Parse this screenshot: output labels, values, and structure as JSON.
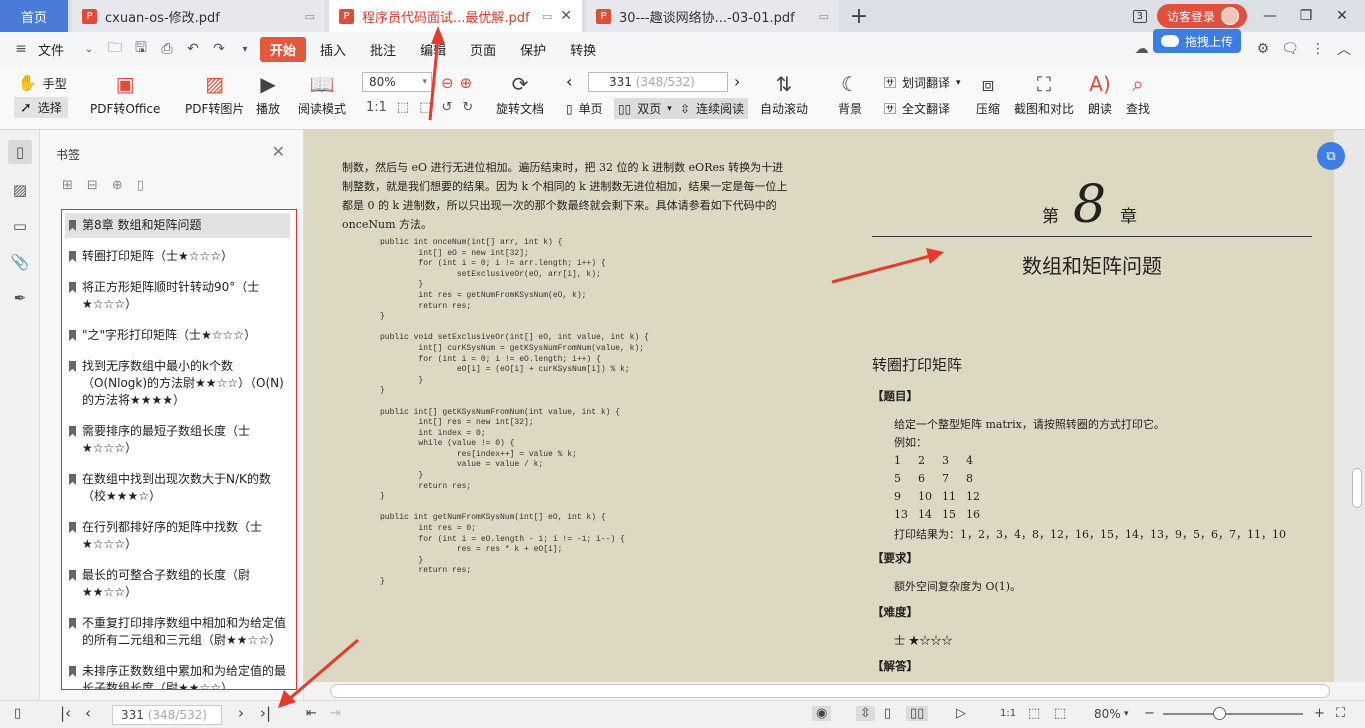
{
  "tabs": {
    "home": "首页",
    "items": [
      {
        "title": "cxuan-os-修改.pdf"
      },
      {
        "title": "程序员代码面试...最优解.pdf"
      },
      {
        "title": "30---趣谈网络协...-03-01.pdf"
      }
    ],
    "new_tab": "+",
    "window_count": "3",
    "visitor_login": "访客登录"
  },
  "menubar": {
    "file": "文件",
    "items": [
      "开始",
      "插入",
      "批注",
      "编辑",
      "页面",
      "保护",
      "转换"
    ],
    "upload": "拖拽上传"
  },
  "toolbar": {
    "hand": "手型",
    "select": "选择",
    "pdf_to_office": "PDF转Office",
    "pdf_to_image": "PDF转图片",
    "play": "播放",
    "read_mode": "阅读模式",
    "zoom": "80%",
    "rotate": "旋转文档",
    "page_current": "331",
    "page_total": "(348/532)",
    "single": "单页",
    "double": "双页",
    "continuous": "连续阅读",
    "auto_scroll": "自动滚动",
    "background": "背景",
    "word_translate": "划词翻译",
    "full_translate": "全文翻译",
    "compress": "压缩",
    "screenshot_compare": "截图和对比",
    "read_aloud": "朗读",
    "search": "查找"
  },
  "bookmarks": {
    "title": "书签",
    "items": [
      "第8章 数组和矩阵问题",
      "转圈打印矩阵（士★☆☆☆）",
      "将正方形矩阵顺时针转动90°（士★☆☆☆）",
      "\"之\"字形打印矩阵（士★☆☆☆）",
      "找到无序数组中最小的k个数（O(Nlogk)的方法尉★★☆☆）（O(N)的方法将★★★★）",
      "需要排序的最短子数组长度（士★☆☆☆）",
      "在数组中找到出现次数大于N/K的数（校★★★☆）",
      "在行列都排好序的矩阵中找数（士★☆☆☆）",
      "最长的可整合子数组的长度（尉★★☆☆）",
      "不重复打印排序数组中相加和为给定值的所有二元组和三元组（尉★★☆☆）",
      "未排序正数数组中累加和为给定值的最长子数组长度（尉★★☆☆）"
    ]
  },
  "page_left": {
    "paragraph": "制数，然后与 eO 进行无进位相加。遍历结束时，把 32 位的 k 进制数 eORes 转换为十进制整数，就是我们想要的结果。因为 k 个相同的 k 进制数无进位相加，结果一定是每一位上都是 0 的 k 进制数，所以只出现一次的那个数最终就会剩下来。具体请参看如下代码中的 onceNum 方法。",
    "code": "public int onceNum(int[] arr, int k) {\n        int[] eO = new int[32];\n        for (int i = 0; i != arr.length; i++) {\n                setExclusiveOr(eO, arr[i], k);\n        }\n        int res = getNumFromKSysNum(eO, k);\n        return res;\n}\n\npublic void setExclusiveOr(int[] eO, int value, int k) {\n        int[] curKSysNum = getKSysNumFromNum(value, k);\n        for (int i = 0; i != eO.length; i++) {\n                eO[i] = (eO[i] + curKSysNum[i]) % k;\n        }\n}\n\npublic int[] getKSysNumFromNum(int value, int k) {\n        int[] res = new int[32];\n        int index = 0;\n        while (value != 0) {\n                res[index++] = value % k;\n                value = value / k;\n        }\n        return res;\n}\n\npublic int getNumFromKSysNum(int[] eO, int k) {\n        int res = 0;\n        for (int i = eO.length - 1; i != -1; i--) {\n                res = res * k + eO[i];\n        }\n        return res;\n}"
  },
  "page_right": {
    "chapter_prefix": "第",
    "chapter_num": "8",
    "chapter_suffix": "章",
    "chapter_title": "数组和矩阵问题",
    "section_title": "转圈打印矩阵",
    "label_problem": "【题目】",
    "problem_text": "给定一个整型矩阵 matrix，请按照转圈的方式打印它。",
    "example": "例如：",
    "matrix": [
      [
        "1",
        "2",
        "3",
        "4"
      ],
      [
        "5",
        "6",
        "7",
        "8"
      ],
      [
        "9",
        "10",
        "11",
        "12"
      ],
      [
        "13",
        "14",
        "15",
        "16"
      ]
    ],
    "print_result": "打印结果为：1，2，3，4，8，12，16，15，14，13，9，5，6，7，11，10",
    "label_req": "【要求】",
    "req_text": "额外空间复杂度为 O(1)。",
    "label_diff": "【难度】",
    "diff_text": "士 ★☆☆☆",
    "label_answer": "【解答】"
  },
  "statusbar": {
    "page_current": "331",
    "page_total": "(348/532)",
    "zoom": "80%"
  },
  "colors": {
    "accent": "#e05a3c",
    "home_tab": "#4a7bd8",
    "page_bg": "#ddd8c2",
    "annotation_red": "#e63a2e"
  }
}
